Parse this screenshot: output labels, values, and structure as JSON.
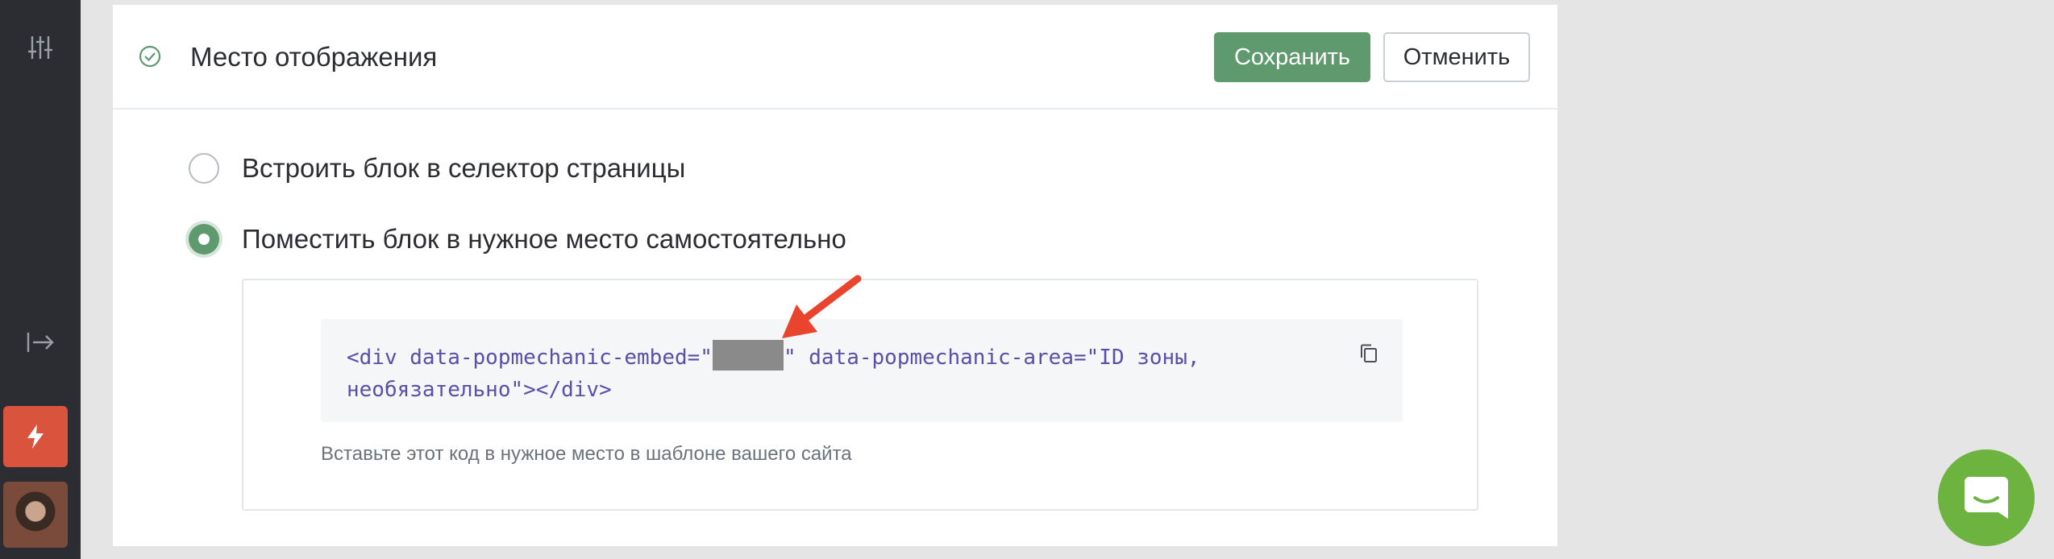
{
  "header": {
    "title": "Место отображения",
    "save_label": "Сохранить",
    "cancel_label": "Отменить"
  },
  "options": [
    {
      "label": "Встроить блок в селектор страницы",
      "selected": false
    },
    {
      "label": "Поместить блок в нужное место самостоятельно",
      "selected": true
    }
  ],
  "embed": {
    "code_before": "<div data-popmechanic-embed=\"",
    "code_after": "\" data-popmechanic-area=\"ID зоны, необязательно\"></div>",
    "hint": "Вставьте этот код в нужное место в шаблоне вашего сайта"
  },
  "colors": {
    "accent": "#5f9a6e",
    "sidebar": "#2b2d33",
    "bolt": "#d9533d",
    "chat": "#6cb33f",
    "arrow": "#e8442e"
  },
  "icons": {
    "sidebar_top": "sliders-icon",
    "sidebar_mid": "logout-arrow-icon",
    "sidebar_bolt": "lightning-icon",
    "header": "check-circle-icon",
    "copy": "copy-icon",
    "chat": "chat-icon"
  }
}
